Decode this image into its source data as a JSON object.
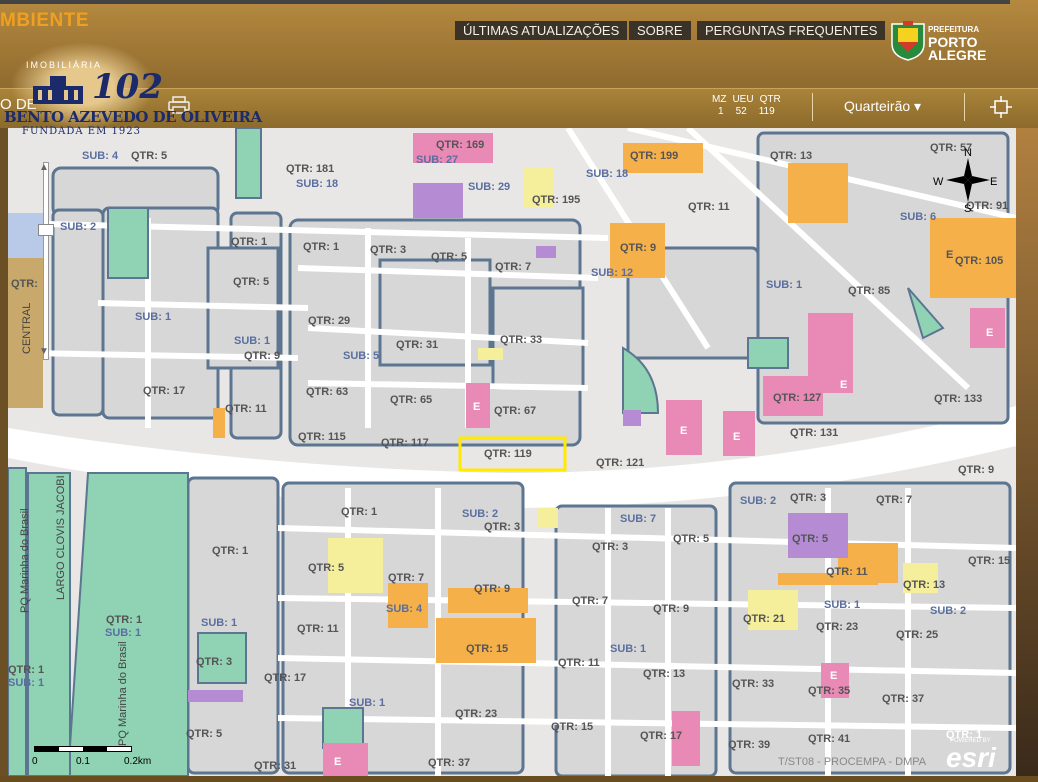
{
  "header": {
    "brand_partial": "MBIENTE",
    "nav": [
      "ÚLTIMAS ATUALIZAÇÕES",
      "SOBRE",
      "PERGUNTAS FREQUENTES"
    ],
    "prefeitura": {
      "line1": "PREFEITURA",
      "line2": "PORTO",
      "line3": "ALEGRE"
    }
  },
  "logo": {
    "top": "IMOBILIÁRIA",
    "number": "102",
    "name": "BENTO AZEVEDO DE OLIVEIRA",
    "founded": "FUNDADA EM 1923"
  },
  "toolbar": {
    "side_text": "O DE",
    "codes_headers": [
      "MZ",
      "UEU",
      "QTR"
    ],
    "codes_values": [
      "1",
      "52",
      "119"
    ],
    "level_select": "Quarteirão ▾",
    "level_icon": "caret-down-icon"
  },
  "map": {
    "compass": [
      "N",
      "S",
      "E",
      "W"
    ],
    "scale_labels": [
      "0",
      "0.1",
      "0.2km"
    ],
    "attribution": "T/ST08 - PROCEMPA - DMPA",
    "powered": "POWERED BY",
    "esri": "esri",
    "highlighted_block": "QTR: 119",
    "street_labels": [
      "CENTRAL",
      "LARGO CLOVIS JACOBI",
      "PQ Marinha do Brasil",
      "PQ Marinha do Brasil"
    ],
    "labels": [
      "SUB: 4",
      "QTR: 5",
      "QTR: 181",
      "SUB: 18",
      "QTR: 169",
      "SUB: 27",
      "SUB: 29",
      "QTR: 195",
      "QTR: 199",
      "SUB: 18",
      "QTR: 13",
      "QTR: 57",
      "QTR: 11",
      "SUB: 6",
      "QTR: 91",
      "SUB: 2",
      "QTR: 1",
      "QTR: 1",
      "QTR: 3",
      "QTR: 5",
      "QTR: 7",
      "QTR: 9",
      "SUB: 12",
      "E",
      "QTR: 105",
      "QTR:",
      "QTR: 5",
      "SUB: 1",
      "QTR: 85",
      "SUB: 1",
      "QTR: 29",
      "SUB: 1",
      "QTR: 31",
      "QTR: 33",
      "E",
      "QTR: 9",
      "SUB: 5",
      "QTR: 17",
      "QTR: 63",
      "QTR: 65",
      "E",
      "QTR: 67",
      "E",
      "QTR: 127",
      "QTR: 11",
      "QTR: 133",
      "E",
      "E",
      "QTR: 115",
      "QTR: 117",
      "QTR: 119",
      "QTR: 121",
      "QTR: 131",
      "QTR: 9",
      "SUB: 2",
      "QTR: 3",
      "QTR: 7",
      "QTR: 1",
      "SUB: 2",
      "QTR: 3",
      "SUB: 7",
      "QTR: 5",
      "QTR: 3",
      "QTR: 5",
      "QTR: 1",
      "QTR: 5",
      "QTR: 7",
      "QTR: 9",
      "QTR: 11",
      "QTR: 13",
      "QTR: 15",
      "SUB: 4",
      "QTR: 7",
      "QTR: 9",
      "SUB: 1",
      "QTR: 21",
      "QTR: 23",
      "SUB: 2",
      "QTR: 1",
      "SUB: 1",
      "SUB: 1",
      "QTR: 11",
      "QTR: 15",
      "QTR: 25",
      "QTR: 3",
      "SUB: 1",
      "QTR: 11",
      "QTR: 13",
      "QTR: 33",
      "E",
      "QTR: 35",
      "QTR: 17",
      "QTR: 37",
      "QTR: 1",
      "SUB: 1",
      "SUB: 1",
      "QTR: 23",
      "QTR: 15",
      "QTR: 5",
      "QTR: 17",
      "QTR: 41",
      "QTR: 39",
      "E",
      "QTR: 31",
      "QTR: 37",
      "QTR: 1"
    ]
  },
  "colors": {
    "yellow_highlight": "#ffea00",
    "block_outline": "#5c7590",
    "green": "#8fd2b4",
    "pink": "#e98ab6",
    "orange": "#f5b04a",
    "purple": "#b58cd4"
  }
}
